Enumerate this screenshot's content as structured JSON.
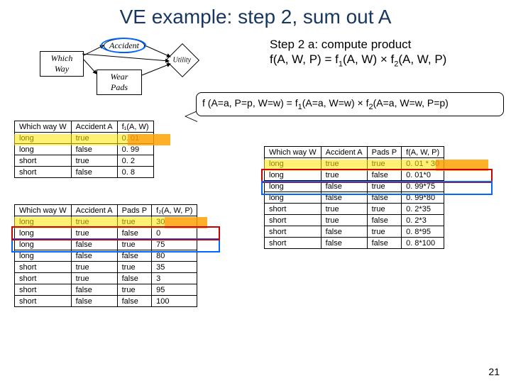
{
  "title": "VE example: step 2, sum out A",
  "step": {
    "line1": "Step 2 a: compute product",
    "line2_pre": "f(A, W, P) = f",
    "line2_sub1": "1",
    "line2_mid": "(A, W)  ×  f",
    "line2_sub2": "2",
    "line2_post": "(A, W, P)"
  },
  "speech": {
    "pre": "f (A=a, P=p, W=w)  =  f",
    "sub1": "1",
    "mid1": "(A=a, W=w)  ×  f",
    "sub2": "2",
    "mid2": "(A=a, W=w, P=p)"
  },
  "diagram": {
    "whichway": "Which Way",
    "accident": "Accident",
    "wearpads": "Wear Pads",
    "utility": "Utility"
  },
  "t1": {
    "headers": [
      "Which way W",
      "Accident A",
      "f₁(A, W)"
    ],
    "rows": [
      [
        "long",
        "true",
        "0. 01"
      ],
      [
        "long",
        "false",
        "0. 99"
      ],
      [
        "short",
        "true",
        "0. 2"
      ],
      [
        "short",
        "false",
        "0. 8"
      ]
    ]
  },
  "t2": {
    "headers": [
      "Which way W",
      "Accident A",
      "Pads P",
      "f₂(A, W, P)"
    ],
    "rows": [
      [
        "long",
        "true",
        "true",
        "30"
      ],
      [
        "long",
        "true",
        "false",
        "0"
      ],
      [
        "long",
        "false",
        "true",
        "75"
      ],
      [
        "long",
        "false",
        "false",
        "80"
      ],
      [
        "short",
        "true",
        "true",
        "35"
      ],
      [
        "short",
        "true",
        "false",
        "3"
      ],
      [
        "short",
        "false",
        "true",
        "95"
      ],
      [
        "short",
        "false",
        "false",
        "100"
      ]
    ]
  },
  "t3": {
    "headers": [
      "Which way W",
      "Accident A",
      "Pads P",
      "f(A, W, P)"
    ],
    "rows": [
      [
        "long",
        "true",
        "true",
        "0. 01 * 30"
      ],
      [
        "long",
        "true",
        "false",
        "0. 01*0"
      ],
      [
        "long",
        "false",
        "true",
        "0. 99*75"
      ],
      [
        "long",
        "false",
        "false",
        "0. 99*80"
      ],
      [
        "short",
        "true",
        "true",
        "0. 2*35"
      ],
      [
        "short",
        "true",
        "false",
        "0. 2*3"
      ],
      [
        "short",
        "false",
        "true",
        "0. 8*95"
      ],
      [
        "short",
        "false",
        "false",
        "0. 8*100"
      ]
    ]
  },
  "pagenum": "21"
}
